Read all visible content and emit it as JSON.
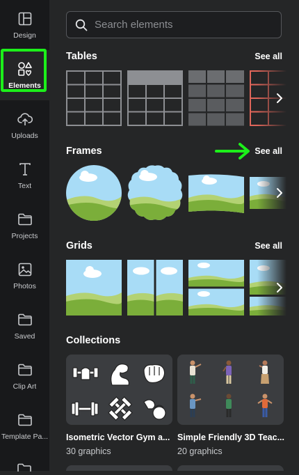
{
  "sidebar": {
    "items": [
      {
        "label": "Design",
        "icon": "layout-icon"
      },
      {
        "label": "Elements",
        "icon": "shapes-icon",
        "active": true
      },
      {
        "label": "Uploads",
        "icon": "cloud-upload-icon"
      },
      {
        "label": "Text",
        "icon": "text-icon"
      },
      {
        "label": "Projects",
        "icon": "folder-icon"
      },
      {
        "label": "Photos",
        "icon": "image-icon"
      },
      {
        "label": "Saved",
        "icon": "folder-icon"
      },
      {
        "label": "Clip Art",
        "icon": "folder-icon"
      },
      {
        "label": "Template Pa...",
        "icon": "folder-icon"
      }
    ]
  },
  "search": {
    "placeholder": "Search elements"
  },
  "sections": {
    "tables": {
      "title": "Tables",
      "see_all": "See all"
    },
    "frames": {
      "title": "Frames",
      "see_all": "See all"
    },
    "grids": {
      "title": "Grids",
      "see_all": "See all"
    },
    "collections": {
      "title": "Collections"
    }
  },
  "collections": [
    {
      "title": "Isometric Vector Gym a...",
      "subtitle": "30 graphics"
    },
    {
      "title": "Simple Friendly 3D Teac...",
      "subtitle": "20 graphics"
    }
  ],
  "colors": {
    "highlight": "#1cf01a",
    "sky": "#a8dcf6",
    "grass": "#7bae3a",
    "table_red": "#e0665a"
  }
}
